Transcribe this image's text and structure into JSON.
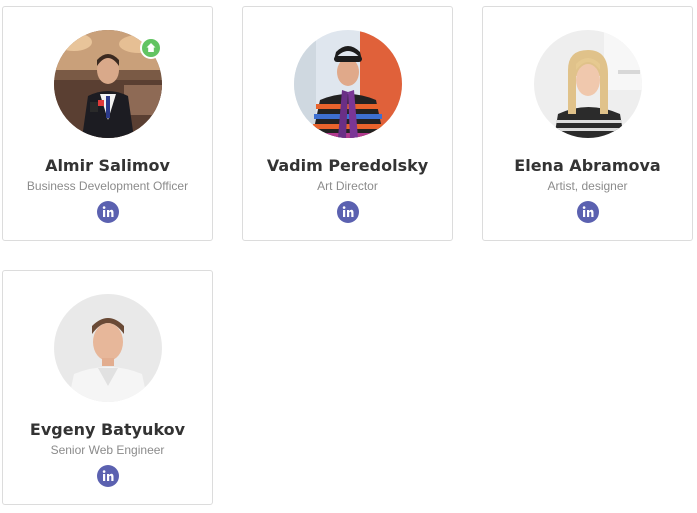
{
  "team": {
    "members": [
      {
        "name": "Almir Salimov",
        "role": "Business Development Officer",
        "social": "linkedin-icon",
        "badge": "arrow-up-icon"
      },
      {
        "name": "Vadim Peredolsky",
        "role": "Art Director",
        "social": "linkedin-icon"
      },
      {
        "name": "Elena Abramova",
        "role": "Artist, designer",
        "social": "linkedin-icon"
      },
      {
        "name": "Evgeny Batyukov",
        "role": "Senior Web Engineer",
        "social": "linkedin-icon"
      }
    ]
  },
  "colors": {
    "linkedin_button": "#5b61b0",
    "badge_green": "#62c462",
    "name_text": "#333333",
    "role_text": "#8b8b8b",
    "card_border": "#dcdcdc"
  }
}
